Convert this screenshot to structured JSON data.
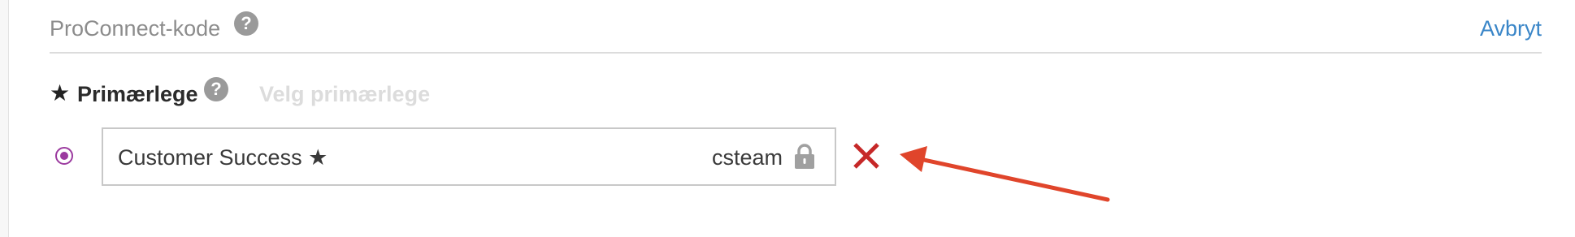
{
  "header": {
    "title": "ProConnect-kode",
    "help_icon": "question-circle-icon",
    "cancel_label": "Avbryt"
  },
  "primary": {
    "star_icon": "★",
    "label": "Primærlege",
    "help_icon": "question-circle-icon",
    "select_label": "Velg primærlege"
  },
  "entry": {
    "name": "Customer Success ★",
    "username": "csteam",
    "lock_icon": "lock-icon",
    "remove_icon": "x-icon",
    "selected": true
  },
  "colors": {
    "accent_link": "#3a86c8",
    "radio": "#9b3a9f",
    "remove": "#c62828",
    "annotation_arrow": "#e0452b",
    "muted_text": "#8c8c8c",
    "disabled_text": "#dcdcdc"
  }
}
